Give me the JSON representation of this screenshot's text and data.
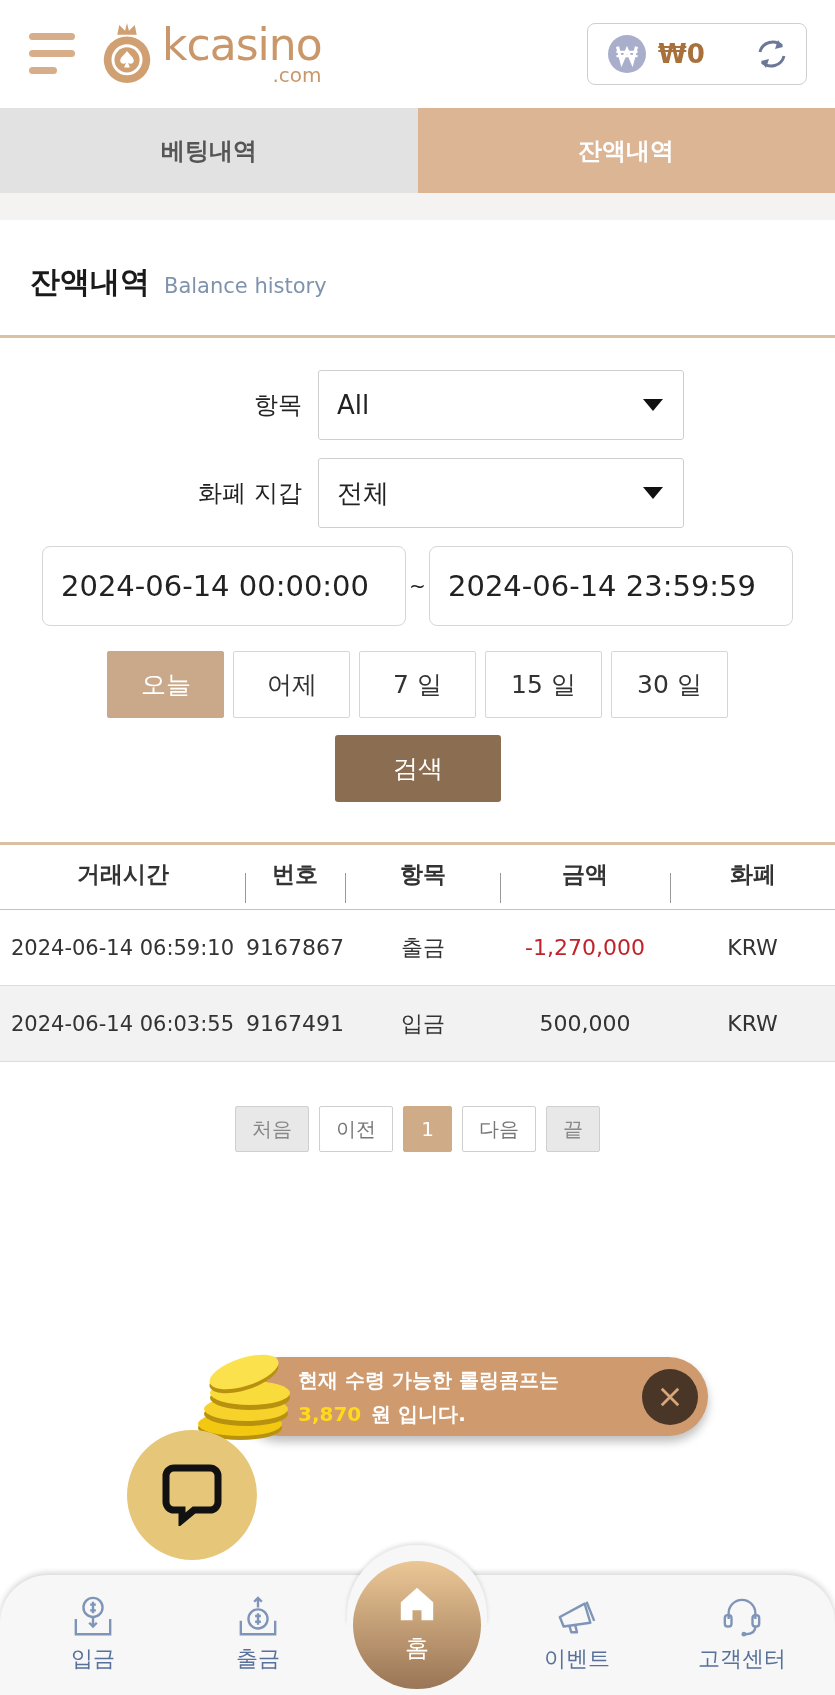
{
  "header": {
    "logo": {
      "name": "kcasino",
      "suffix": ".com"
    },
    "balance": "₩0"
  },
  "tabs": [
    {
      "label": "베팅내역",
      "selected": false
    },
    {
      "label": "잔액내역",
      "selected": true
    }
  ],
  "section": {
    "title": "잔액내역",
    "subtitle": "Balance history"
  },
  "filters": [
    {
      "label": "항목",
      "value": "All"
    },
    {
      "label": "화폐 지갑",
      "value": "전체"
    }
  ],
  "date_range": {
    "start": "2024-06-14 00:00:00",
    "separator": "~",
    "end": "2024-06-14 23:59:59"
  },
  "periods": [
    {
      "label": "오늘",
      "selected": true
    },
    {
      "label": "어제",
      "selected": false
    },
    {
      "label": "7 일",
      "selected": false
    },
    {
      "label": "15 일",
      "selected": false
    },
    {
      "label": "30 일",
      "selected": false
    }
  ],
  "search_button": "검색",
  "table": {
    "columns": [
      "거래시간",
      "번호",
      "항목",
      "금액",
      "화폐"
    ],
    "rows": [
      {
        "time": "2024-06-14 06:59:10",
        "number": "9167867",
        "type": "출금",
        "amount": "-1,270,000",
        "negative": true,
        "currency": "KRW"
      },
      {
        "time": "2024-06-14 06:03:55",
        "number": "9167491",
        "type": "입금",
        "amount": "500,000",
        "negative": false,
        "currency": "KRW"
      }
    ]
  },
  "pagination": [
    {
      "label": "처음",
      "disabled": true,
      "selected": false
    },
    {
      "label": "이전",
      "disabled": false,
      "selected": false
    },
    {
      "label": "1",
      "disabled": false,
      "selected": true
    },
    {
      "label": "다음",
      "disabled": false,
      "selected": false
    },
    {
      "label": "끝",
      "disabled": true,
      "selected": false
    }
  ],
  "popup": {
    "line1": "현재 수령 가능한 롤링콤프는",
    "amount": "3,870",
    "line2": "원 입니다."
  },
  "bottom_nav": [
    {
      "label": "입금",
      "kind": "deposit"
    },
    {
      "label": "출금",
      "kind": "withdraw"
    },
    {
      "label": "홈",
      "kind": "home"
    },
    {
      "label": "이벤트",
      "kind": "event"
    },
    {
      "label": "고객센터",
      "kind": "support"
    }
  ]
}
